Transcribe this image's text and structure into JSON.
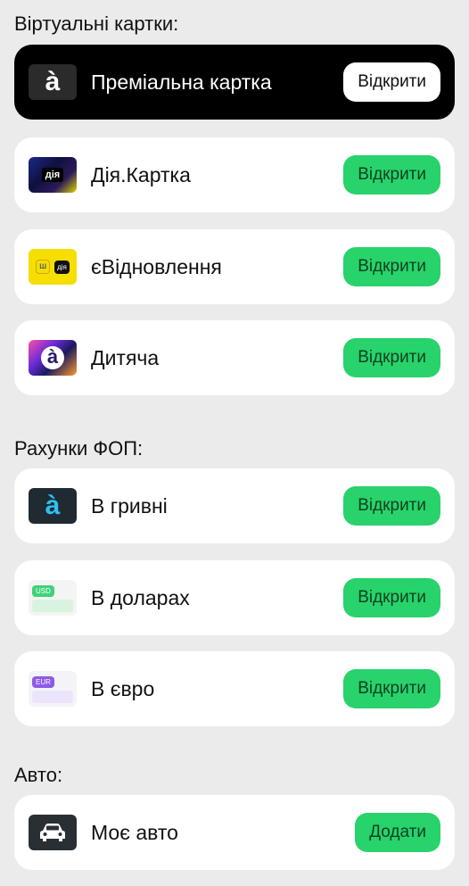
{
  "sections": {
    "virtual_cards": "Віртуальні картки:",
    "fop_accounts": "Рахунки ФОП:",
    "auto": "Авто:"
  },
  "cards": [
    {
      "label": "Преміальна картка",
      "button": "Відкрити",
      "thumb_text": "à"
    },
    {
      "label": "Дія.Картка",
      "button": "Відкрити",
      "thumb_text": "дія"
    },
    {
      "label": "єВідновлення",
      "button": "Відкрити",
      "thumb_text": "дія"
    },
    {
      "label": "Дитяча",
      "button": "Відкрити",
      "thumb_text": "à"
    }
  ],
  "fop": [
    {
      "label": "В гривні",
      "button": "Відкрити",
      "thumb_text": "à"
    },
    {
      "label": "В доларах",
      "button": "Відкрити",
      "thumb_text": "USD"
    },
    {
      "label": "В євро",
      "button": "Відкрити",
      "thumb_text": "EUR"
    }
  ],
  "auto_items": [
    {
      "label": "Моє авто",
      "button": "Додати"
    }
  ],
  "colors": {
    "background": "#ebebeb",
    "card": "#ffffff",
    "premium_card": "#000000",
    "accent_green": "#27d36a"
  },
  "icons": {
    "car": "car-icon"
  }
}
